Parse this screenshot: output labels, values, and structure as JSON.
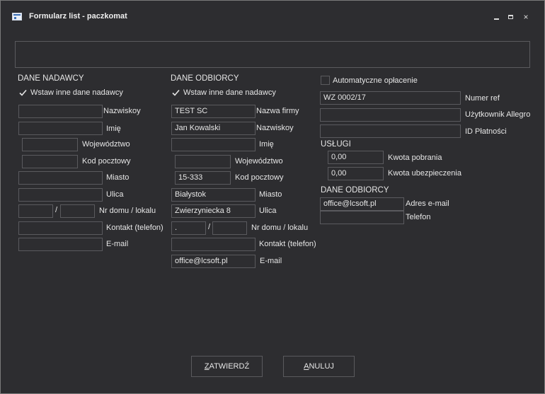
{
  "window": {
    "title": "Formularz list - paczkomat",
    "controls": {
      "minimize": "minimize",
      "maximize": "maximize",
      "close": "×"
    }
  },
  "sender": {
    "header": "DANE NADAWCY",
    "checkbox_label": "Wstaw inne dane nadawcy",
    "checkbox_checked": true,
    "fields": {
      "surname": {
        "label": "Nazwiskoy",
        "value": ""
      },
      "first_name": {
        "label": "Imię",
        "value": ""
      },
      "province": {
        "label": "Województwo",
        "value": ""
      },
      "postal_code": {
        "label": "Kod pocztowy",
        "value": ""
      },
      "city": {
        "label": "Miasto",
        "value": ""
      },
      "street": {
        "label": "Ulica",
        "value": ""
      },
      "house_no": {
        "label": "Nr domu / lokalu",
        "value_house": "",
        "value_flat": "",
        "separator": "/"
      },
      "phone": {
        "label": "Kontakt (telefon)",
        "value": ""
      },
      "email": {
        "label": "E-mail",
        "value": ""
      }
    }
  },
  "recipient": {
    "header": "DANE ODBIORCY",
    "checkbox_label": "Wstaw inne dane nadawcy",
    "checkbox_checked": true,
    "fields": {
      "company": {
        "label": "Nazwa firmy",
        "value": "TEST SC"
      },
      "surname": {
        "label": "Nazwiskoy",
        "value": "Jan Kowalski"
      },
      "first_name": {
        "label": "Imię",
        "value": ""
      },
      "province": {
        "label": "Województwo",
        "value": ""
      },
      "postal_code": {
        "label": "Kod pocztowy",
        "value": "15-333"
      },
      "city": {
        "label": "Miasto",
        "value": "Białystok"
      },
      "street": {
        "label": "Ulica",
        "value": "Zwierzyniecka 8"
      },
      "house_no": {
        "label": "Nr domu / lokalu",
        "value_house": ".",
        "value_flat": "",
        "separator": "/"
      },
      "phone": {
        "label": "Kontakt (telefon)",
        "value": ""
      },
      "email": {
        "label": "E-mail",
        "value": "office@lcsoft.pl"
      }
    }
  },
  "right": {
    "auto_payment_label": "Automatyczne opłacenie",
    "auto_payment_checked": false,
    "ref_no": {
      "label": "Numer ref",
      "value": "WZ 0002/17"
    },
    "allegro_user": {
      "label": "Użytkownik Allegro",
      "value": ""
    },
    "payment_id": {
      "label": "ID Płatności",
      "value": ""
    },
    "services_header": "USŁUGI",
    "cod_amount": {
      "label": "Kwota pobrania",
      "value": "0,00"
    },
    "insurance_amount": {
      "label": "Kwota ubezpieczenia",
      "value": "0,00"
    },
    "recipient_header": "DANE ODBIORCY",
    "email": {
      "label": "Adres e-mail",
      "value": "office@lcsoft.pl"
    },
    "phone": {
      "label": "Telefon",
      "value": ""
    }
  },
  "buttons": {
    "confirm": {
      "mnemonic": "Z",
      "rest": "ATWIERDŹ"
    },
    "cancel": {
      "mnemonic": "A",
      "rest": "NULUJ"
    }
  }
}
